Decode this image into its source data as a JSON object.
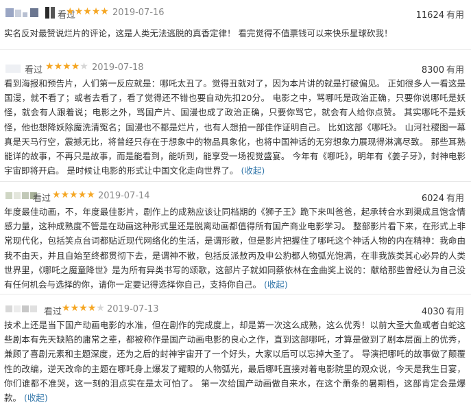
{
  "reviews": [
    {
      "status": "看过",
      "rating": 5,
      "date": "2019-07-16",
      "votes": "11624",
      "useful_label": "有用",
      "content": "实名反对最赞说烂片的评论，这是人类无法逃脱的真香定律！ 看完觉得不值票钱可以来快乐星球砍我！",
      "fold": ""
    },
    {
      "status": "看过",
      "rating": 4,
      "date": "2019-07-18",
      "votes": "8300",
      "useful_label": "有用",
      "content": "看到海报和预告片，人们第一反应就是：哪吒太丑了。觉得丑就对了，因为本片讲的就是打破偏见。 正如很多人一看这是国漫，就不看了；或者去看了，看了觉得还不错也要自动先扣20分。 电影之中，骂哪吒是政治正确，只要你说哪吒是妖怪，就会有人跟着说；电影之外，骂国产片、国漫也成了政治正确，只要你骂它，就会有人给你点赞。 其实哪吒不是妖怪，他也想降妖除魔洗清冤名；国漫也不都是烂片，也有人想拍一部佳作证明自己。 比如这部《哪吒》。 山河社稷图一幕真是天马行空，震撼无比，将曾经只存在于想象中的物品具象化，也将中国神话的无穷想象力展现得淋漓尽致。 那些耳熟能详的故事，不再只是故事，而是能看到，能听到，能享受一场视觉盛宴。 今年有《哪吒》，明年有《姜子牙》，封神电影宇宙即将开启。 是时候让电影的形式让中国文化走向世界了。",
      "fold": "(收起)"
    },
    {
      "status": "看过",
      "rating": 5,
      "date": "2019-07-14",
      "votes": "6024",
      "useful_label": "有用",
      "content": "年度最佳动画，不，年度最佳影片，剧作上的成熟应该让同档期的《狮子王》跪下来叫爸爸，起承转合水到渠成且饱含情感力量，这种成熟度不管是在动画这种形式里还是脱离动画都值得所有国产商业电影学习。 整部影片看下来，在形式上非常现代化，包括笑点台词都贴近现代网络化的生活，是谓形散，但是影片把握住了哪吒这个神话人物的内在精神：我命由我不由天，并且自始至终都贯彻下去，是谓神不散，包括反派敖丙及申公豹都人物弧光饱满，在非我族类其心必异的人类世界里，《哪吒之魔童降世》是为所有异类书写的颂歌，这部片子就如同蔡依林在金曲奖上说的：献给那些曾经认为自己没有任何机会与选择的你，请你一定要记得选择你自己，支持你自己。",
      "fold": "(收起)"
    },
    {
      "status": "看过",
      "rating": 4,
      "date": "2019-07-13",
      "votes": "4030",
      "useful_label": "有用",
      "content": "技术上还是当下国产动画电影的水准，但在剧作的完成度上，却是第一次这么成熟，这么优秀！以前大圣大鱼或者白蛇这些剧本有先天缺陷的庸常之辈，都被称作是国产动画电影的良心之作，直到这部哪吒，才算是做到了剧本层面上的优秀，兼顾了喜剧元素和主题深度，还为之后的封神宇宙开了一个好头，大家以后可以忘掉大圣了。 导演把哪吒的故事做了颠覆性的改编，逆天改命的主题在哪吒身上爆发了耀眼的人物弧光，最后哪吒直接对着电影院里的观众说，今天是我生日宴，你们谁都不准哭，这一刻的泪点实在是太可怕了。 第一次给国产动画做自来水，在这个萧条的暑期档，这部肯定会是爆款。",
      "fold": "(收起)"
    }
  ],
  "colors": {
    "star_on": "#f5a623",
    "star_off": "#d6d6d6",
    "link": "#3377aa",
    "text": "#333333"
  }
}
